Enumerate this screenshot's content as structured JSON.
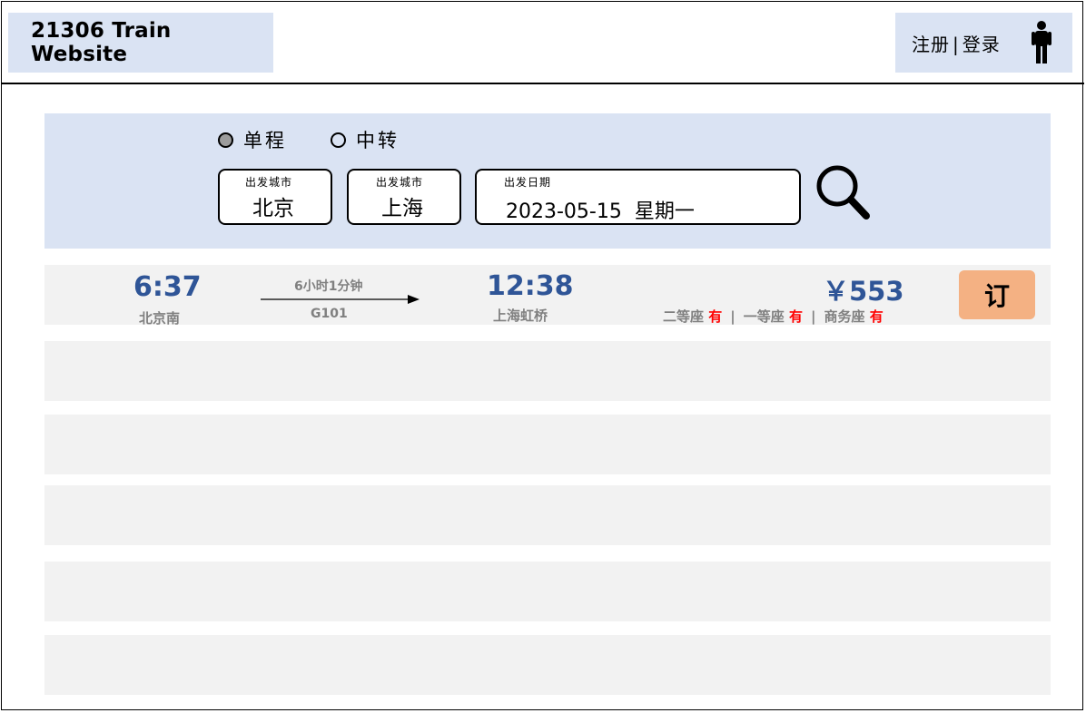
{
  "header": {
    "brand": "21306 Train Website",
    "register_label": "注册",
    "separator": "|",
    "login_label": "登录",
    "user_icon": "person-icon"
  },
  "search": {
    "trip_types": [
      {
        "label": "单程",
        "selected": true
      },
      {
        "label": "中转",
        "selected": false
      }
    ],
    "from": {
      "caption": "出发城市",
      "value": "北京"
    },
    "to": {
      "caption": "出发城市",
      "value": "上海"
    },
    "date": {
      "caption": "出发日期",
      "value": "2023-05-15  星期一"
    },
    "search_icon": "magnifier-icon"
  },
  "results": [
    {
      "depart_time": "6:37",
      "depart_station": "北京南",
      "duration": "6小时1分钟",
      "train_no": "G101",
      "arrive_time": "12:38",
      "arrive_station": "上海虹桥",
      "price": "￥553",
      "seats": [
        {
          "name": "二等座",
          "status": "有"
        },
        {
          "name": "一等座",
          "status": "有"
        },
        {
          "name": "商务座",
          "status": "有"
        }
      ],
      "seat_separator": "|",
      "book_label": "订"
    }
  ],
  "colors": {
    "panel": "#dae3f3",
    "row": "#f2f2f2",
    "accent_blue": "#2f5597",
    "book_button": "#f4b183",
    "available": "#ff0000"
  }
}
